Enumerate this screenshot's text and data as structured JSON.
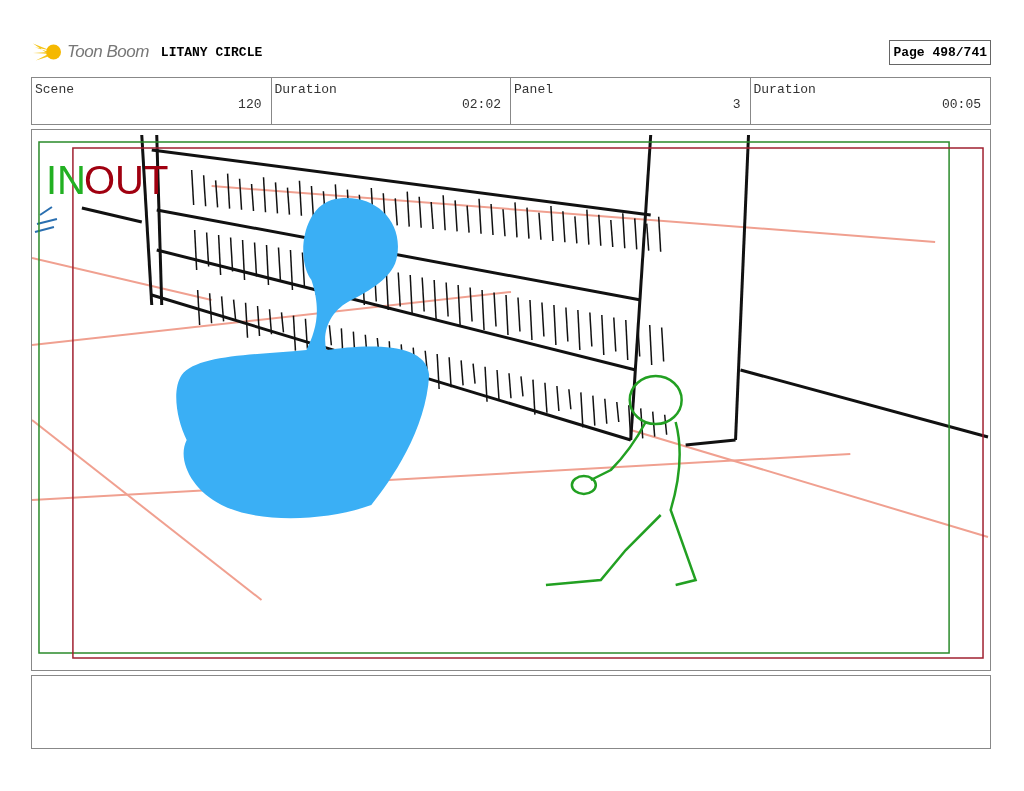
{
  "header": {
    "logo": "Toon Boom",
    "title": "LITANY CIRCLE",
    "page": "Page 498/741"
  },
  "info": [
    {
      "label": "Scene",
      "value": "120"
    },
    {
      "label": "Duration",
      "value": "02:02"
    },
    {
      "label": "Panel",
      "value": "3"
    },
    {
      "label": "Duration",
      "value": "00:05"
    }
  ],
  "panel": {
    "in_label": "IN",
    "out_label": "OUT"
  }
}
